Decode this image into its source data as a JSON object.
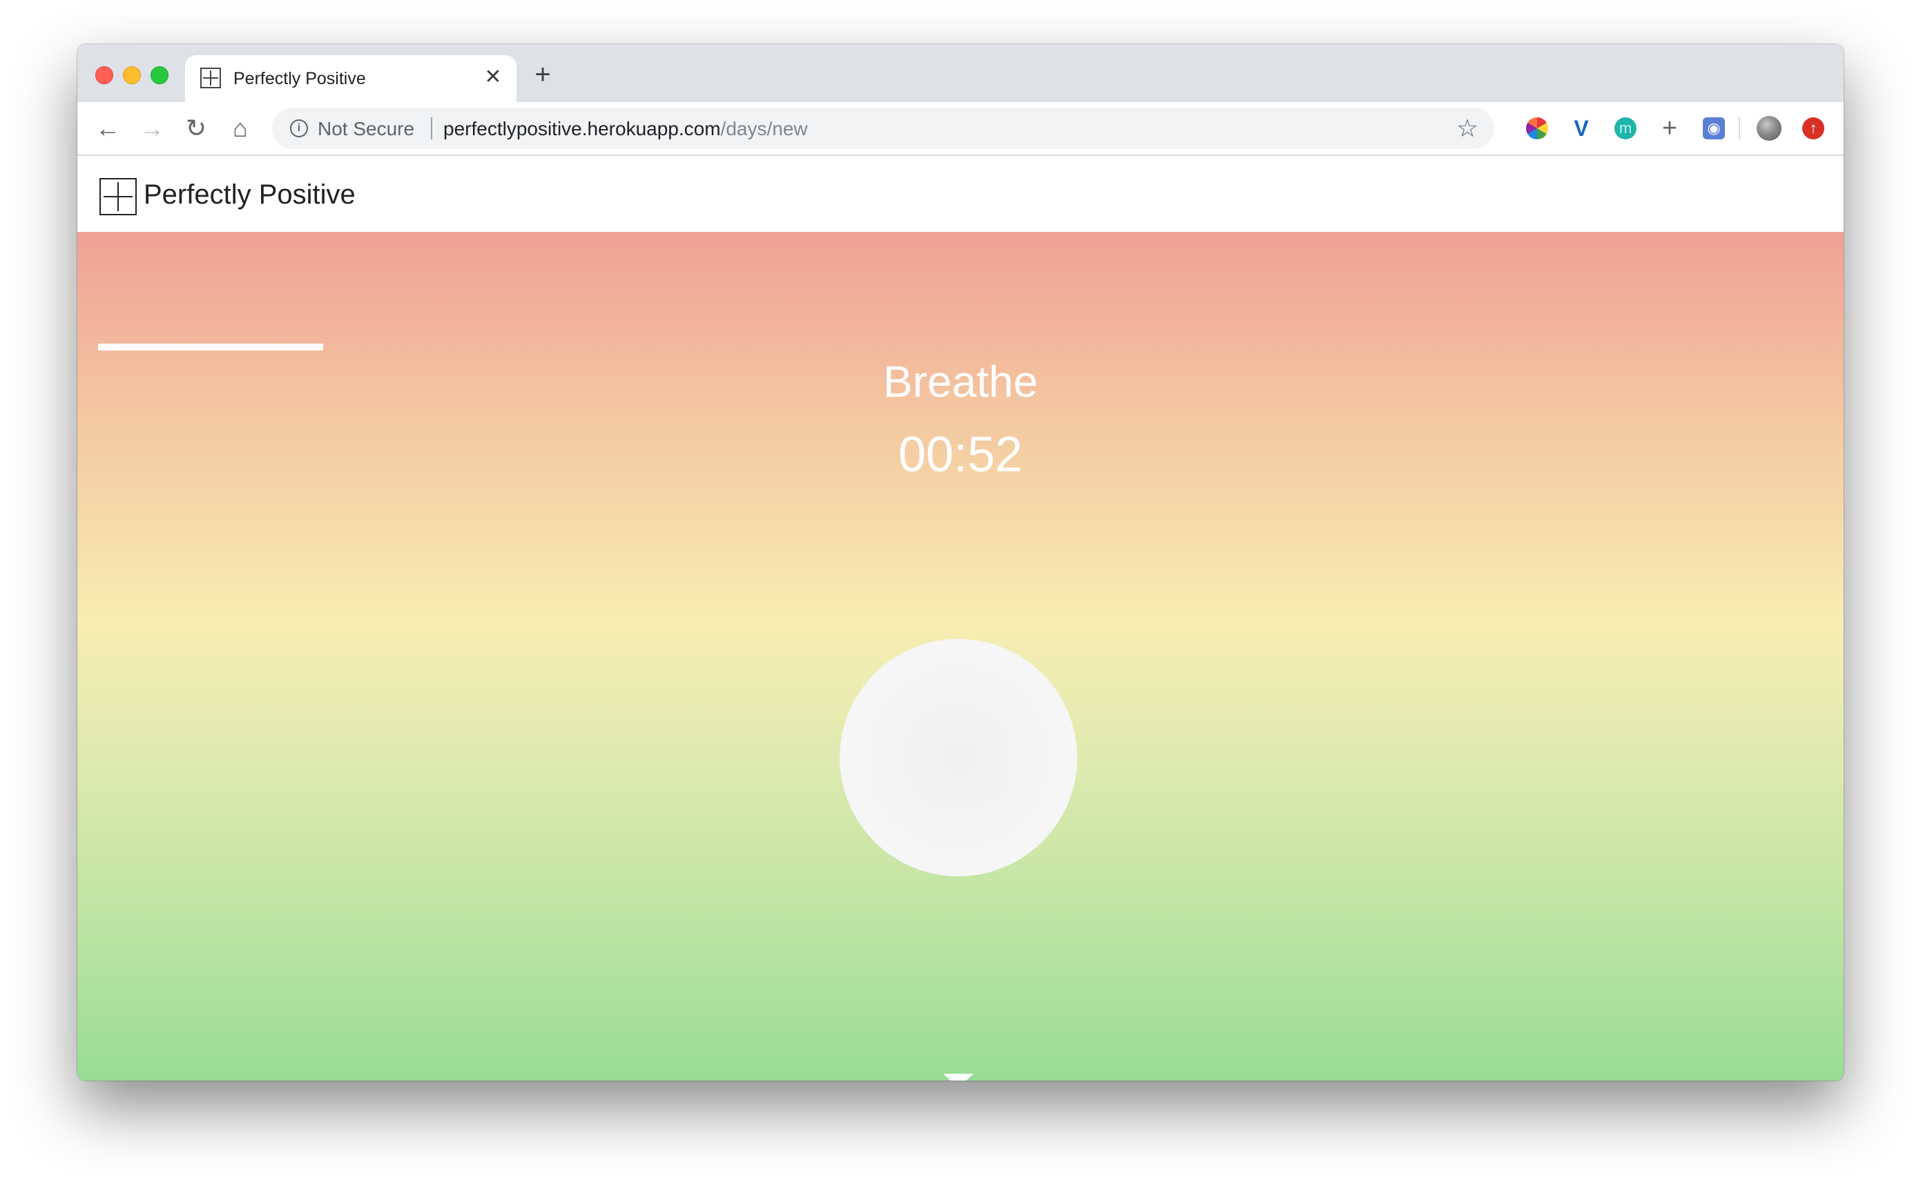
{
  "browser": {
    "tab": {
      "title": "Perfectly Positive",
      "close_glyph": "✕"
    },
    "new_tab_glyph": "+",
    "nav": {
      "back_glyph": "←",
      "forward_glyph": "→",
      "reload_glyph": "↻",
      "home_glyph": "⌂"
    },
    "omnibox": {
      "security_label": "Not Secure",
      "url_host": "perfectlypositive.herokuapp.com",
      "url_path": "/days/new",
      "star_glyph": "☆"
    },
    "extensions": [
      {
        "icon": "color-wheel-icon"
      },
      {
        "icon": "v-extension-icon",
        "glyph": "V"
      },
      {
        "icon": "m-extension-icon",
        "glyph": "m"
      },
      {
        "icon": "crosshair-icon",
        "glyph": "+"
      },
      {
        "icon": "camera-icon",
        "glyph": "◉"
      }
    ],
    "update_glyph": "↑"
  },
  "site": {
    "brand": "Perfectly Positive"
  },
  "exercise": {
    "phase": "Breathe",
    "timer": "00:52",
    "progress_fraction": 0.13
  },
  "colors": {
    "gradient_top": "#f0a194",
    "gradient_mid": "#f8edb2",
    "gradient_bottom": "#98dd94",
    "circle": "#f5f5f5"
  }
}
